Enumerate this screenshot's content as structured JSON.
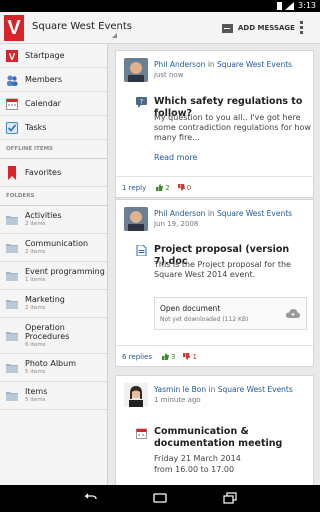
{
  "status_bar": {
    "time": "3:13"
  },
  "action_bar": {
    "app_title": "Square West Events",
    "add_message_label": "ADD MESSAGE",
    "logo_letter": "V",
    "brand_color": "#d9232a"
  },
  "sidebar": {
    "nav_items": [
      {
        "label": "Startpage",
        "icon": "startpage-icon"
      },
      {
        "label": "Members",
        "icon": "members-icon"
      },
      {
        "label": "Calendar",
        "icon": "calendar-icon"
      },
      {
        "label": "Tasks",
        "icon": "tasks-icon"
      }
    ],
    "offline_header": "OFFLINE ITEMS",
    "favorites_label": "Favorites",
    "folders_header": "FOLDERS",
    "folders": [
      {
        "name": "Activities",
        "count": "2 items"
      },
      {
        "name": "Communication",
        "count": "2 items"
      },
      {
        "name": "Event programming",
        "count": "1 items"
      },
      {
        "name": "Marketing",
        "count": "2 items"
      },
      {
        "name": "Operation Procedures",
        "count": "6 items"
      },
      {
        "name": "Photo Album",
        "count": "5 items"
      },
      {
        "name": "Items",
        "count": "5 items"
      }
    ]
  },
  "feed": {
    "posts": [
      {
        "author": "Phil Anderson",
        "in_word": "in",
        "group": "Square West Events",
        "date": "just now",
        "type_icon": "question-icon",
        "title": "Which safety regulations to follow?",
        "body": "My question to you all.. I've got here some contradiction regulations for how many fire...",
        "read_more": "Read more",
        "replies": "1 reply",
        "likes": "2",
        "dislikes": "0"
      },
      {
        "author": "Phil Anderson",
        "in_word": "in",
        "group": "Square West Events",
        "date": "Jun 19, 2008",
        "type_icon": "document-icon",
        "title": "Project proposal (version 7).doc",
        "body": "This is the Project proposal for the Square West 2014 event.",
        "open_document": "Open document",
        "download_status": "Not yet downloaded (112 KB)",
        "replies": "6 replies",
        "likes": "3",
        "dislikes": "1"
      },
      {
        "author": "Yasmin le Bon",
        "in_word": "in",
        "group": "Square West Events",
        "date": "1 minute ago",
        "type_icon": "calendar-icon",
        "title": "Communication & documentation meeting",
        "date_line": "Friday 21 March 2014",
        "time_line": "from 16.00 to 17.00"
      }
    ]
  }
}
